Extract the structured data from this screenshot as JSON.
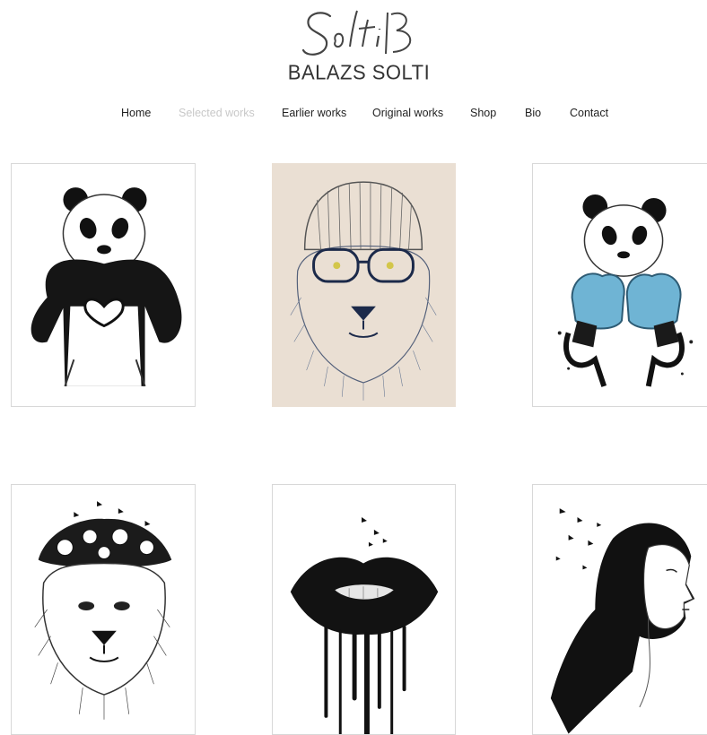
{
  "brand": {
    "script_logo": "Solti B",
    "name": "BALAZS SOLTI"
  },
  "nav": {
    "items": [
      {
        "label": "Home",
        "active": false
      },
      {
        "label": "Selected works",
        "active": true
      },
      {
        "label": "Earlier works",
        "active": false
      },
      {
        "label": "Original works",
        "active": false
      },
      {
        "label": "Shop",
        "active": false
      },
      {
        "label": "Bio",
        "active": false
      },
      {
        "label": "Contact",
        "active": false
      }
    ]
  },
  "gallery": {
    "artworks": [
      {
        "icon": "panda-heart-artwork"
      },
      {
        "icon": "lion-glasses-beanie-artwork"
      },
      {
        "icon": "panda-boxing-gloves-artwork"
      },
      {
        "icon": "lion-flower-crown-artwork"
      },
      {
        "icon": "dripping-lips-artwork"
      },
      {
        "icon": "woman-profile-birds-artwork"
      }
    ]
  },
  "colors": {
    "nav_active": "#c8c8c8",
    "tile_border": "#d8d8d8",
    "lion_bg": "#eadfd3",
    "boxing_gloves": "#6fb4d4"
  }
}
